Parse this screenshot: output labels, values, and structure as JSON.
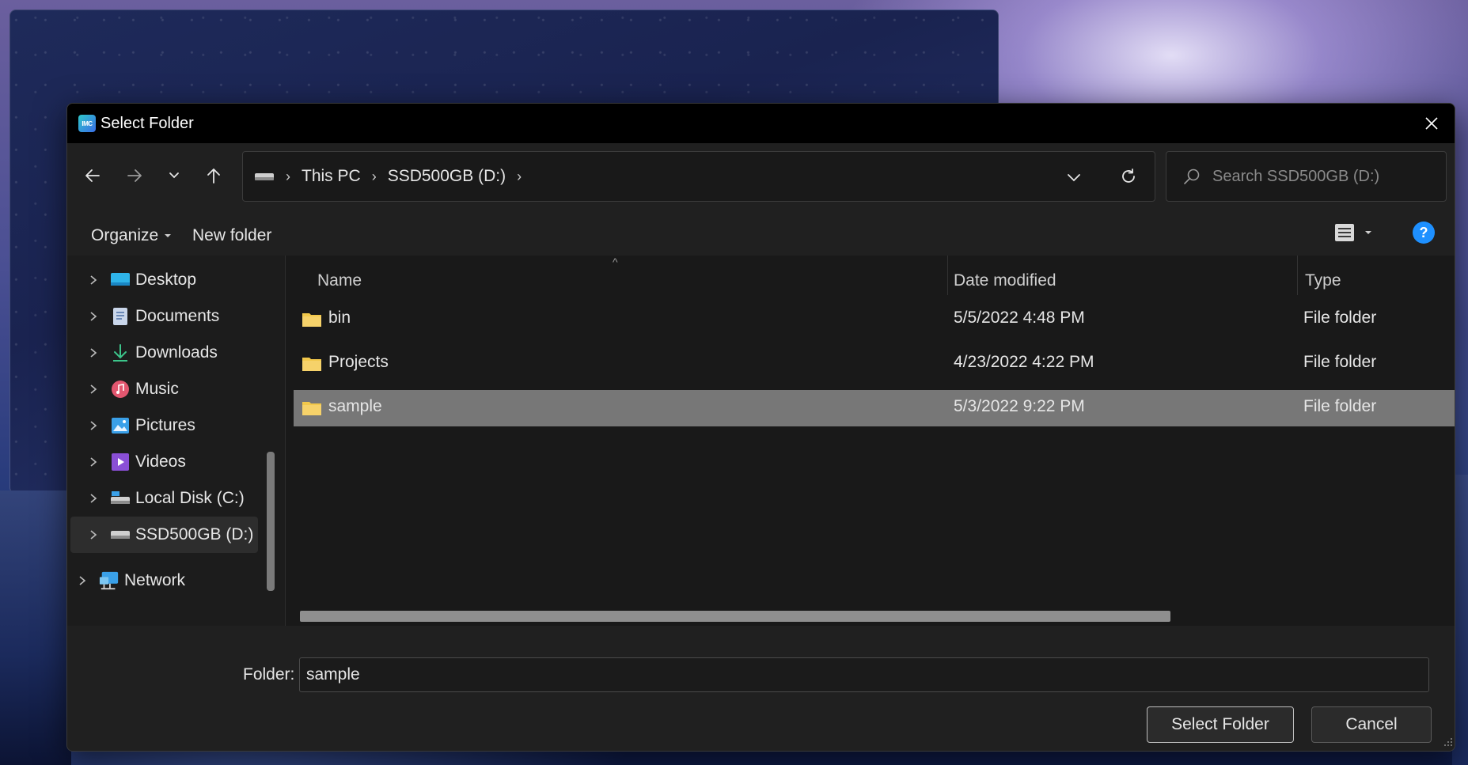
{
  "dialog": {
    "title": "Select Folder",
    "app_icon_text": "IMC"
  },
  "navigation": {
    "back_icon": "arrow-left-icon",
    "forward_icon": "arrow-right-icon",
    "recent_icon": "chevron-down-icon",
    "up_icon": "arrow-up-icon"
  },
  "address_bar": {
    "crumbs": [
      "This PC",
      "SSD500GB (D:)"
    ],
    "drive_icon": "drive-icon",
    "dropdown_icon": "chevron-down-icon",
    "refresh_icon": "refresh-icon"
  },
  "search": {
    "placeholder": "Search SSD500GB (D:)",
    "icon": "search-icon"
  },
  "commandbar": {
    "organize": "Organize",
    "new_folder": "New folder",
    "view_icon": "list-view-icon",
    "help_icon": "help-icon"
  },
  "sidebar": {
    "items": [
      {
        "label": "Desktop",
        "icon": "desktop-icon"
      },
      {
        "label": "Documents",
        "icon": "documents-icon"
      },
      {
        "label": "Downloads",
        "icon": "downloads-icon"
      },
      {
        "label": "Music",
        "icon": "music-icon"
      },
      {
        "label": "Pictures",
        "icon": "pictures-icon"
      },
      {
        "label": "Videos",
        "icon": "videos-icon"
      },
      {
        "label": "Local Disk (C:)",
        "icon": "drive-icon"
      },
      {
        "label": "SSD500GB (D:)",
        "icon": "drive-icon",
        "selected": true
      },
      {
        "label": "Network",
        "icon": "network-icon"
      }
    ]
  },
  "files": {
    "columns": {
      "name": "Name",
      "date": "Date modified",
      "type": "Type"
    },
    "rows": [
      {
        "name": "bin",
        "date": "5/5/2022 4:48 PM",
        "type": "File folder"
      },
      {
        "name": "Projects",
        "date": "4/23/2022 4:22 PM",
        "type": "File folder"
      },
      {
        "name": "sample",
        "date": "5/3/2022 9:22 PM",
        "type": "File folder",
        "selected": true
      }
    ]
  },
  "footer": {
    "folder_label": "Folder:",
    "folder_value": "sample",
    "select_button": "Select Folder",
    "cancel_button": "Cancel"
  },
  "colors": {
    "accent": "#4cc2ff",
    "folder": "#f2c84b",
    "selection": "#777777"
  }
}
